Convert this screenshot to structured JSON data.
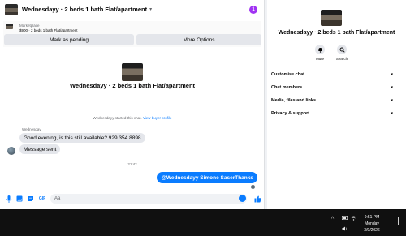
{
  "chat": {
    "title": "Wednesdayy · 2 beds 1 bath Flat/apartment",
    "badge": "1",
    "listing": {
      "kind": "Marketplace",
      "description": "$900 · 2 beds 1 bath Flat/apartment"
    },
    "buttons": {
      "pending": "Mark as pending",
      "more": "More Options"
    },
    "thread_title": "Wednesdayy · 2 beds 1 bath Flat/apartment",
    "started_text": "Wednesdayy started this chat. ",
    "started_link": "View buyer profile",
    "sender": "Wednesday",
    "messages_in": [
      "Good evening, is this still available? 929 354 8898",
      "Message sent"
    ],
    "time": "21:42",
    "message_out": "@Wednesdayy Simone SaserThanks",
    "composer_placeholder": "Aa",
    "gif_label": "GIF"
  },
  "info": {
    "title": "Wednesdayy · 2 beds 1 bath Flat/apartment",
    "actions": {
      "mute": "Mute",
      "search": "Search"
    },
    "sections": [
      "Customise chat",
      "Chat members",
      "Media, files and links",
      "Privacy & support"
    ]
  },
  "taskbar": {
    "time": "9:51 PM",
    "day": "Monday",
    "date": "3/9/2026"
  },
  "colors": {
    "accent": "#0a7cff",
    "badge": "#a033f3"
  }
}
